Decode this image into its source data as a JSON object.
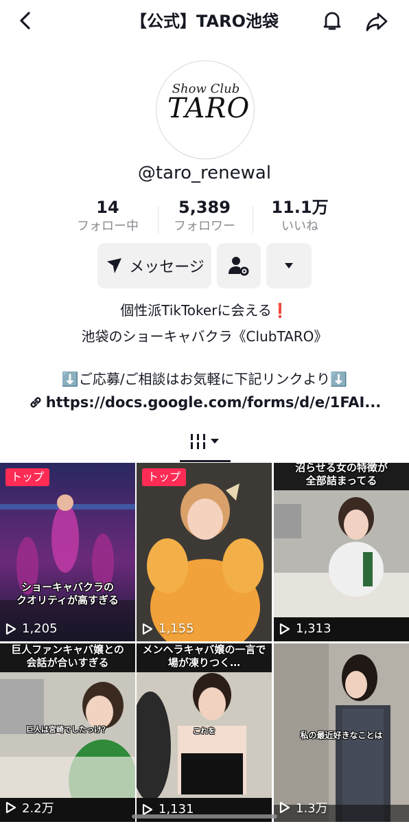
{
  "header": {
    "title": "【公式】TARO池袋"
  },
  "profile": {
    "logo_small": "Show Club",
    "logo_big": "TARO",
    "username": "@taro_renewal",
    "stats": [
      {
        "value": "14",
        "label": "フォロー中"
      },
      {
        "value": "5,389",
        "label": "フォロワー"
      },
      {
        "value": "11.1万",
        "label": "いいね"
      }
    ],
    "message_label": "メッセージ",
    "bio": [
      "個性派TikTokerに会える❗️",
      "池袋のショーキャバクラ《ClubTARO》",
      "⬇️ご応募/ご相談はお気軽に下記リンクより⬇️"
    ],
    "link": "https://docs.google.com/forms/d/e/1FAI..."
  },
  "videos": [
    {
      "badge": "トップ",
      "caption_lines": [
        "ショーキャバクラの",
        "クオリティが高すぎる"
      ],
      "views": "1,205"
    },
    {
      "badge": "トップ",
      "caption_lines": [],
      "views": "1,155"
    },
    {
      "badge": "",
      "caption_lines": [
        "沼らせる女の特徴が",
        "全部詰まってる"
      ],
      "views": "1,313"
    },
    {
      "badge": "",
      "caption_lines": [
        "巨人ファンキャバ嬢との",
        "会話が合いすぎる"
      ],
      "sub_caption": "巨人は宮崎でしたっけ？",
      "views": "2.2万"
    },
    {
      "badge": "",
      "caption_lines": [
        "メンヘラキャバ嬢の一言で",
        "場が凍りつく…"
      ],
      "sub_caption": "これを",
      "views": "1,131"
    },
    {
      "badge": "",
      "caption_lines": [],
      "mid_caption": "私の最近好きなことは",
      "views": "1.3万"
    }
  ],
  "colors": {
    "accent": "#fe2c55",
    "text": "#161823",
    "muted": "#8a8b91"
  }
}
